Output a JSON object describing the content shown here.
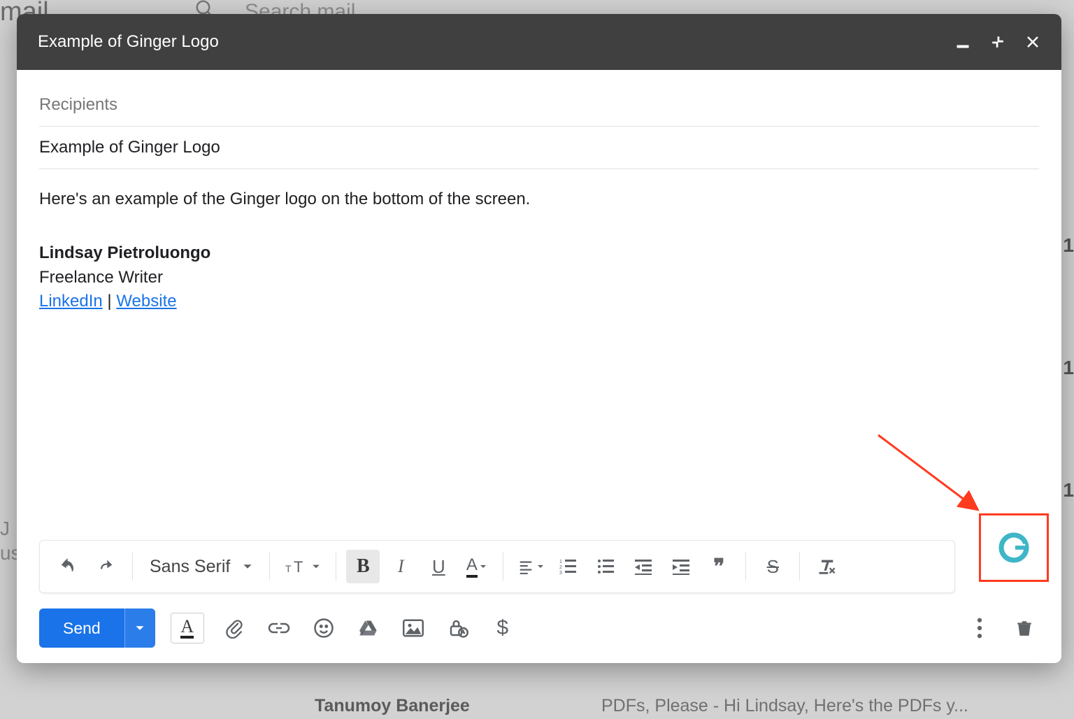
{
  "background": {
    "app_name_fragment": "mail",
    "search_placeholder": "Search mail",
    "left_fragment1": "J",
    "left_fragment2": "ust",
    "right_time_fragment": "1",
    "inbox_sender": "Tanumoy Banerjee",
    "inbox_snippet": "PDFs, Please - Hi Lindsay, Here's the PDFs y..."
  },
  "compose": {
    "title": "Example of Ginger Logo",
    "recipients_placeholder": "Recipients",
    "subject": "Example of Ginger Logo",
    "body_line1": "Here's an example of the Ginger logo on the bottom of the screen.",
    "signature": {
      "name": "Lindsay Pietroluongo",
      "role": "Freelance Writer",
      "link1": "LinkedIn",
      "separator": " | ",
      "link2": "Website"
    }
  },
  "toolbar": {
    "font_family": "Sans Serif",
    "bold_glyph": "B",
    "italic_glyph": "I",
    "underline_glyph": "U",
    "textcolor_glyph": "A",
    "strike_glyph": "S",
    "quote_glyph": "❞"
  },
  "actions": {
    "send_label": "Send",
    "formatting_glyph": "A",
    "money_glyph": "$"
  },
  "annotation": {
    "color": "#ff3b1f"
  }
}
